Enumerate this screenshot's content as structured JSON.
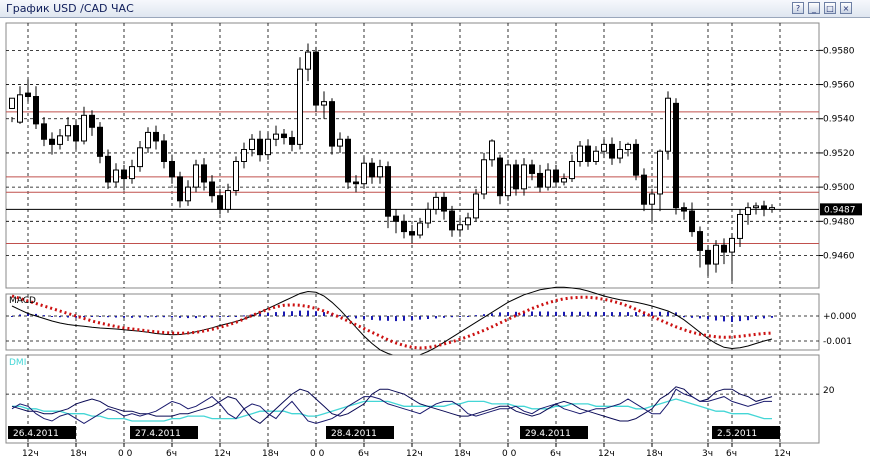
{
  "window": {
    "title": "График USD /CAD  ЧАС",
    "buttons": [
      "?",
      "_",
      "□",
      "×"
    ]
  },
  "chart_data": {
    "type": "candlestick",
    "symbol": "USD/CAD",
    "timeframe": "ЧАС",
    "grid": true,
    "price_axis": {
      "ticks": [
        "0.9580",
        "0.9560",
        "0.9540",
        "0.9520",
        "0.9500",
        "0.9480",
        "0.9460"
      ],
      "ylim": [
        0.9441,
        0.9596
      ]
    },
    "current_price": "0.9487",
    "horizontal_lines": [
      0.9544,
      0.9506,
      0.9497,
      0.9487,
      0.9467
    ],
    "line_colors": {
      "support_resistance": "#c0504d",
      "current": "#000000"
    },
    "candles": [
      [
        0.9546,
        0.9552,
        0.9541,
        0.9538
      ],
      [
        0.9538,
        0.9554,
        0.9559,
        0.9537
      ],
      [
        0.9555,
        0.9553,
        0.9563,
        0.955
      ],
      [
        0.9553,
        0.9537,
        0.9559,
        0.9534
      ],
      [
        0.9537,
        0.9528,
        0.9541,
        0.9524
      ],
      [
        0.9528,
        0.9525,
        0.9532,
        0.9519
      ],
      [
        0.9525,
        0.953,
        0.9534,
        0.9522
      ],
      [
        0.953,
        0.9536,
        0.9541,
        0.9527
      ],
      [
        0.9536,
        0.9527,
        0.9539,
        0.9522
      ],
      [
        0.9527,
        0.9542,
        0.9547,
        0.9525
      ],
      [
        0.9542,
        0.9535,
        0.9545,
        0.953
      ],
      [
        0.9535,
        0.9518,
        0.9538,
        0.9514
      ],
      [
        0.9518,
        0.9503,
        0.9522,
        0.9499
      ],
      [
        0.9503,
        0.951,
        0.9514,
        0.95
      ],
      [
        0.951,
        0.9505,
        0.9513,
        0.9498
      ],
      [
        0.9505,
        0.9512,
        0.9516,
        0.9502
      ],
      [
        0.9512,
        0.9523,
        0.9527,
        0.9509
      ],
      [
        0.9523,
        0.9532,
        0.9535,
        0.952
      ],
      [
        0.9532,
        0.9527,
        0.9536,
        0.9522
      ],
      [
        0.9527,
        0.9515,
        0.9531,
        0.9511
      ],
      [
        0.9515,
        0.9506,
        0.9519,
        0.9502
      ],
      [
        0.9506,
        0.9492,
        0.9509,
        0.9488
      ],
      [
        0.9492,
        0.95,
        0.9504,
        0.9489
      ],
      [
        0.95,
        0.9513,
        0.9516,
        0.9497
      ],
      [
        0.9513,
        0.9503,
        0.9517,
        0.9498
      ],
      [
        0.9503,
        0.9495,
        0.9507,
        0.9491
      ],
      [
        0.9495,
        0.9487,
        0.9499,
        0.9484
      ],
      [
        0.9487,
        0.9498,
        0.9502,
        0.9485
      ],
      [
        0.9498,
        0.9515,
        0.9518,
        0.9495
      ],
      [
        0.9515,
        0.9522,
        0.9526,
        0.9511
      ],
      [
        0.9522,
        0.9528,
        0.9531,
        0.9518
      ],
      [
        0.9528,
        0.9519,
        0.9533,
        0.9515
      ],
      [
        0.9519,
        0.9528,
        0.9532,
        0.9516
      ],
      [
        0.9528,
        0.9531,
        0.9536,
        0.9524
      ],
      [
        0.9531,
        0.9529,
        0.9534,
        0.9525
      ],
      [
        0.9529,
        0.9525,
        0.9533,
        0.9521
      ],
      [
        0.9525,
        0.9569,
        0.9576,
        0.9522
      ],
      [
        0.9569,
        0.9579,
        0.9584,
        0.9562
      ],
      [
        0.9579,
        0.9548,
        0.9582,
        0.9544
      ],
      [
        0.9548,
        0.955,
        0.9556,
        0.954
      ],
      [
        0.955,
        0.9524,
        0.9552,
        0.9519
      ],
      [
        0.9524,
        0.9528,
        0.9532,
        0.952
      ],
      [
        0.9528,
        0.9503,
        0.953,
        0.9499
      ],
      [
        0.9503,
        0.9502,
        0.9507,
        0.9497
      ],
      [
        0.9502,
        0.9514,
        0.9518,
        0.9499
      ],
      [
        0.9514,
        0.9506,
        0.9517,
        0.9502
      ],
      [
        0.9506,
        0.9512,
        0.9516,
        0.9502
      ],
      [
        0.9512,
        0.9483,
        0.9515,
        0.9476
      ],
      [
        0.9483,
        0.948,
        0.9487,
        0.9473
      ],
      [
        0.948,
        0.9474,
        0.9484,
        0.947
      ],
      [
        0.9474,
        0.9472,
        0.9478,
        0.9467
      ],
      [
        0.9472,
        0.9479,
        0.9482,
        0.947
      ],
      [
        0.9479,
        0.9487,
        0.9491,
        0.9476
      ],
      [
        0.9487,
        0.9494,
        0.9497,
        0.9484
      ],
      [
        0.9494,
        0.9486,
        0.9497,
        0.9481
      ],
      [
        0.9486,
        0.9475,
        0.9489,
        0.9471
      ],
      [
        0.9475,
        0.9478,
        0.9482,
        0.9471
      ],
      [
        0.9478,
        0.9482,
        0.9485,
        0.9475
      ],
      [
        0.9482,
        0.9496,
        0.9499,
        0.948
      ],
      [
        0.9496,
        0.9516,
        0.952,
        0.9493
      ],
      [
        0.9516,
        0.9527,
        0.9528,
        0.9512
      ],
      [
        0.9517,
        0.9495,
        0.9519,
        0.949
      ],
      [
        0.9495,
        0.9513,
        0.9516,
        0.9492
      ],
      [
        0.9513,
        0.9499,
        0.9516,
        0.9495
      ],
      [
        0.9499,
        0.9513,
        0.9517,
        0.9495
      ],
      [
        0.9513,
        0.9508,
        0.9516,
        0.9504
      ],
      [
        0.9508,
        0.95,
        0.9513,
        0.9497
      ],
      [
        0.95,
        0.951,
        0.9514,
        0.9498
      ],
      [
        0.951,
        0.9503,
        0.9513,
        0.95
      ],
      [
        0.9503,
        0.9505,
        0.9508,
        0.9501
      ],
      [
        0.9505,
        0.9515,
        0.9519,
        0.9503
      ],
      [
        0.9515,
        0.9524,
        0.9527,
        0.9512
      ],
      [
        0.9524,
        0.9515,
        0.9528,
        0.9512
      ],
      [
        0.9515,
        0.9521,
        0.9524,
        0.9513
      ],
      [
        0.9521,
        0.9525,
        0.9528,
        0.9517
      ],
      [
        0.9525,
        0.9517,
        0.9529,
        0.9513
      ],
      [
        0.9517,
        0.9522,
        0.9527,
        0.9514
      ],
      [
        0.9522,
        0.9525,
        0.9526,
        0.9518
      ],
      [
        0.9525,
        0.9507,
        0.9528,
        0.9504
      ],
      [
        0.9507,
        0.949,
        0.9511,
        0.9486
      ],
      [
        0.949,
        0.9496,
        0.9499,
        0.948
      ],
      [
        0.9496,
        0.9521,
        0.9522,
        0.9486
      ],
      [
        0.9521,
        0.9552,
        0.9556,
        0.9516
      ],
      [
        0.9549,
        0.9488,
        0.9552,
        0.9484
      ],
      [
        0.9488,
        0.9486,
        0.9491,
        0.9481
      ],
      [
        0.9486,
        0.9474,
        0.9491,
        0.9471
      ],
      [
        0.9474,
        0.9463,
        0.9477,
        0.9453
      ],
      [
        0.9463,
        0.9455,
        0.9466,
        0.9448
      ],
      [
        0.9455,
        0.9466,
        0.9469,
        0.945
      ],
      [
        0.9466,
        0.9462,
        0.947,
        0.9455
      ],
      [
        0.9462,
        0.947,
        0.9473,
        0.9445
      ],
      [
        0.947,
        0.9484,
        0.9487,
        0.9465
      ],
      [
        0.9484,
        0.9488,
        0.9491,
        0.9478
      ],
      [
        0.9488,
        0.9489,
        0.9491,
        0.9484
      ],
      [
        0.9489,
        0.9487,
        0.9492,
        0.9483
      ],
      [
        0.9487,
        0.9488,
        0.949,
        0.9485
      ]
    ],
    "macd": {
      "label": "MACD",
      "ticks": [
        "+0.000",
        "-0.001"
      ],
      "histogram": [
        0.0,
        5e-05,
        0.0001,
        7e-05,
        3e-05,
        -2e-05,
        -4e-05,
        -5e-05,
        -6e-05,
        -4e-05,
        -3e-05,
        -3e-05,
        -4e-05,
        -5e-05,
        -6e-05,
        -6e-05,
        -5e-05,
        -5e-05,
        -4e-05,
        -4e-05,
        -5e-05,
        -6e-05,
        -7e-05,
        -7e-05,
        -6e-05,
        -5e-05,
        -4e-05,
        -3e-05,
        -1e-05,
        2e-05,
        5e-05,
        8e-05,
        0.0001,
        0.00013,
        0.00015,
        0.00016,
        0.00018,
        0.00018,
        0.00016,
        0.00013,
        8e-05,
        3e-05,
        -4e-05,
        -8e-05,
        -0.00011,
        -0.00013,
        -0.00015,
        -0.00016,
        -0.00017,
        -0.00016,
        -0.00014,
        -0.00012,
        -0.0001,
        -8e-05,
        -6e-05,
        -4e-05,
        -2e-05,
        0.0,
        3e-05,
        6e-05,
        9e-05,
        0.00012,
        0.00013,
        0.00014,
        0.00014,
        0.00015,
        0.00015,
        0.00015,
        0.00014,
        0.00014,
        0.00014,
        0.00014,
        0.00014,
        0.00014,
        0.00013,
        0.00013,
        0.00013,
        0.00013,
        0.00013,
        0.00014,
        0.00014,
        0.00014,
        0.00014,
        0.00012,
        -4e-05,
        -6e-05,
        -8e-05,
        -0.00011,
        -0.00015,
        -0.00018,
        -0.0002,
        -0.00017,
        -0.00014,
        -0.0001,
        -8e-05,
        -6e-05
      ],
      "main_line": [
        0.0004,
        0.00025,
        0.0001,
        0.0,
        -0.0001,
        -0.0002,
        -0.00028,
        -0.00034,
        -0.00038,
        -0.00041,
        -0.00045,
        -0.00048,
        -0.0005,
        -0.00052,
        -0.00055,
        -0.00058,
        -0.00061,
        -0.00065,
        -0.0007,
        -0.00073,
        -0.00075,
        -0.00074,
        -0.0007,
        -0.00063,
        -0.00055,
        -0.00047,
        -0.00038,
        -0.0003,
        -0.00022,
        -0.00012,
        0.0,
        0.00015,
        0.0003,
        0.00045,
        0.0006,
        0.00075,
        0.0009,
        0.00098,
        0.00095,
        0.0008,
        0.00055,
        0.00025,
        -0.0001,
        -0.00045,
        -0.0008,
        -0.0011,
        -0.00135,
        -0.0015,
        -0.0016,
        -0.00165,
        -0.00163,
        -0.00155,
        -0.00142,
        -0.00125,
        -0.00105,
        -0.00085,
        -0.00065,
        -0.00045,
        -0.00025,
        -5e-05,
        0.00015,
        0.00035,
        0.00055,
        0.0007,
        0.00085,
        0.00095,
        0.00105,
        0.0011,
        0.00115,
        0.00115,
        0.00112,
        0.00108,
        0.001,
        0.0009,
        0.0008,
        0.00072,
        0.00065,
        0.0006,
        0.00055,
        0.00048,
        0.0004,
        0.0003,
        0.0002,
        5e-05,
        -0.00015,
        -0.0004,
        -0.00065,
        -0.0009,
        -0.0011,
        -0.00125,
        -0.0013,
        -0.00127,
        -0.0012,
        -0.0011,
        -0.001,
        -0.00092
      ],
      "signal": [
        0.0008,
        0.0007,
        0.0006,
        0.0005,
        0.0004,
        0.0003,
        0.0002,
        0.0001,
        0.0,
        -0.0001,
        -0.0002,
        -0.00028,
        -0.00035,
        -0.00042,
        -0.00048,
        -0.00052,
        -0.00056,
        -0.0006,
        -0.00063,
        -0.00066,
        -0.00068,
        -0.00069,
        -0.00068,
        -0.00065,
        -0.0006,
        -0.00053,
        -0.00045,
        -0.00036,
        -0.00025,
        -0.00012,
        2e-05,
        0.00015,
        0.00027,
        0.00037,
        0.00043,
        0.00045,
        0.00043,
        0.00038,
        0.0003,
        0.0002,
        8e-05,
        -5e-05,
        -0.0002,
        -0.00035,
        -0.0005,
        -0.00065,
        -0.0008,
        -0.00095,
        -0.00108,
        -0.00118,
        -0.00125,
        -0.00128,
        -0.00126,
        -0.0012,
        -0.00112,
        -0.00103,
        -0.00093,
        -0.00082,
        -0.0007,
        -0.00057,
        -0.00043,
        -0.00028,
        -0.00013,
        2e-05,
        0.00016,
        0.0003,
        0.00042,
        0.00053,
        0.00062,
        0.00069,
        0.00073,
        0.00075,
        0.00075,
        0.00072,
        0.00067,
        0.0006,
        0.00051,
        0.0004,
        0.00027,
        0.00013,
        -2e-05,
        -0.00016,
        -0.0003,
        -0.00043,
        -0.00055,
        -0.00065,
        -0.00073,
        -0.00079,
        -0.00083,
        -0.00085,
        -0.00084,
        -0.00081,
        -0.00077,
        -0.00073,
        -0.0007,
        -0.00068
      ],
      "colors": {
        "histogram": "#1a1ab0",
        "main": "#000000",
        "signal": "#cc1111"
      }
    },
    "dmi": {
      "label": "DMI",
      "tick": "20",
      "plus_di": [
        15,
        14,
        13,
        13,
        12,
        12,
        13,
        14,
        16,
        17,
        18,
        17,
        15,
        14,
        13,
        13,
        12,
        12,
        11,
        11,
        11,
        12,
        12,
        13,
        14,
        15,
        17,
        19,
        18,
        14,
        10,
        8,
        11,
        14,
        17,
        20,
        22,
        21,
        18,
        15,
        12,
        11,
        12,
        14,
        16,
        20,
        22,
        22,
        21,
        20,
        18,
        16,
        15,
        14,
        13,
        12,
        11,
        11,
        12,
        13,
        14,
        15,
        15,
        13,
        12,
        11,
        12,
        14,
        16,
        17,
        16,
        14,
        13,
        12,
        11,
        10,
        9,
        9,
        10,
        12,
        14,
        18,
        20,
        23,
        22,
        19,
        17,
        18,
        21,
        22,
        22,
        20,
        19,
        17,
        18,
        19
      ],
      "minus_di": [
        14,
        16,
        15,
        12,
        10,
        9,
        11,
        12,
        10,
        8,
        10,
        12,
        14,
        13,
        11,
        12,
        11,
        12,
        13,
        15,
        17,
        16,
        14,
        15,
        17,
        19,
        16,
        12,
        10,
        14,
        16,
        15,
        12,
        10,
        14,
        17,
        13,
        9,
        8,
        9,
        10,
        12,
        15,
        17,
        19,
        19,
        18,
        16,
        15,
        14,
        13,
        12,
        14,
        16,
        17,
        17,
        15,
        12,
        11,
        12,
        13,
        14,
        14,
        15,
        13,
        12,
        14,
        15,
        16,
        14,
        13,
        12,
        13,
        14,
        14,
        15,
        16,
        18,
        16,
        14,
        12,
        12,
        16,
        22,
        20,
        19,
        17,
        17,
        18,
        19,
        17,
        16,
        15,
        16,
        17,
        17
      ],
      "adx": [
        15,
        15,
        14,
        14,
        13,
        13,
        13,
        12,
        12,
        12,
        11,
        11,
        10,
        10,
        10,
        9,
        9,
        9,
        9,
        9,
        10,
        10,
        11,
        11,
        11,
        10,
        10,
        10,
        10,
        11,
        12,
        13,
        13,
        13,
        13,
        12,
        12,
        11,
        11,
        12,
        13,
        14,
        15,
        16,
        17,
        17,
        17,
        17,
        16,
        15,
        15,
        15,
        15,
        15,
        15,
        16,
        16,
        17,
        17,
        17,
        16,
        16,
        16,
        15,
        15,
        14,
        14,
        14,
        15,
        15,
        16,
        16,
        16,
        15,
        15,
        15,
        15,
        15,
        14,
        14,
        15,
        16,
        17,
        18,
        17,
        16,
        15,
        14,
        13,
        13,
        12,
        12,
        12,
        11,
        10,
        10
      ],
      "range": [
        0,
        36
      ],
      "colors": {
        "plus": "#0a0a55",
        "minus": "#1a1a6e",
        "adx": "#44d6d6"
      }
    },
    "x_axis": {
      "date_labels": [
        "26.4.2011",
        "27.4.2011",
        "28.4.2011",
        "29.4.2011",
        "2.5.2011"
      ],
      "hour_labels": [
        "12ч",
        "18ч",
        "0 0",
        "6ч",
        "12ч",
        "18ч",
        "0 0",
        "6ч",
        "12ч",
        "18ч",
        "0 0",
        "6ч",
        "12ч",
        "18ч",
        "3ч",
        "6ч",
        "12ч"
      ],
      "hour_label_bar_index": [
        2,
        8,
        14,
        20,
        26,
        32,
        38,
        44,
        50,
        56,
        62,
        68,
        74,
        80,
        87,
        90,
        96
      ]
    }
  }
}
